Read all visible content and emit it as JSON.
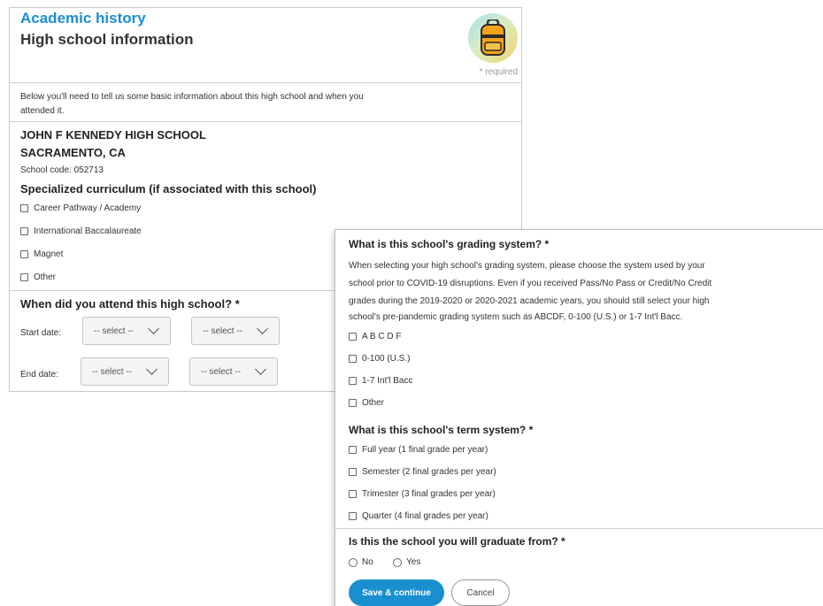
{
  "left_panel": {
    "title": "Academic history",
    "subtitle": "High school information",
    "required_note": "* required",
    "intro_line1": "Below you'll need to tell us some basic information about this high school and when you",
    "intro_line2": "attended it.",
    "school_name": "JOHN F KENNEDY HIGH SCHOOL",
    "school_location": "SACRAMENTO, CA",
    "school_code": "School code: 052713",
    "curriculum_heading": "Specialized curriculum (if associated with this school)",
    "curriculum_options": [
      "Career Pathway / Academy",
      "International Baccalaureate",
      "Magnet",
      "Other"
    ],
    "attend_heading": "When did you attend this high school? *",
    "start_label": "Start date:",
    "end_label": "End date:",
    "select_placeholder": "-- select --"
  },
  "right_panel": {
    "grading_heading": "What is this school's grading system? *",
    "grading_text": [
      "When selecting your high school's grading system, please choose the system used by your",
      "school prior to COVID-19 disruptions. Even if you received Pass/No Pass or Credit/No Credit",
      "grades during the 2019-2020 or 2020-2021 academic years, you should still select your high",
      "school's pre-pandemic grading system such as ABCDF, 0-100 (U.S.) or 1-7 Int'l Bacc."
    ],
    "grading_options": [
      "A B C D F",
      "0-100 (U.S.)",
      "1-7 Int'l Bacc",
      "Other"
    ],
    "term_heading": "What is this school's term system? *",
    "term_options": [
      "Full year (1 final grade per year)",
      "Semester (2 final grades per year)",
      "Trimester (3 final grades per year)",
      "Quarter (4 final grades per year)"
    ],
    "graduate_heading": "Is this the school you will graduate from? *",
    "graduate_options": [
      "No",
      "Yes"
    ],
    "save_label": "Save & continue",
    "cancel_label": "Cancel"
  },
  "colors": {
    "accent": "#1a8fd0"
  },
  "icons": {
    "avatar": "backpack-icon"
  }
}
